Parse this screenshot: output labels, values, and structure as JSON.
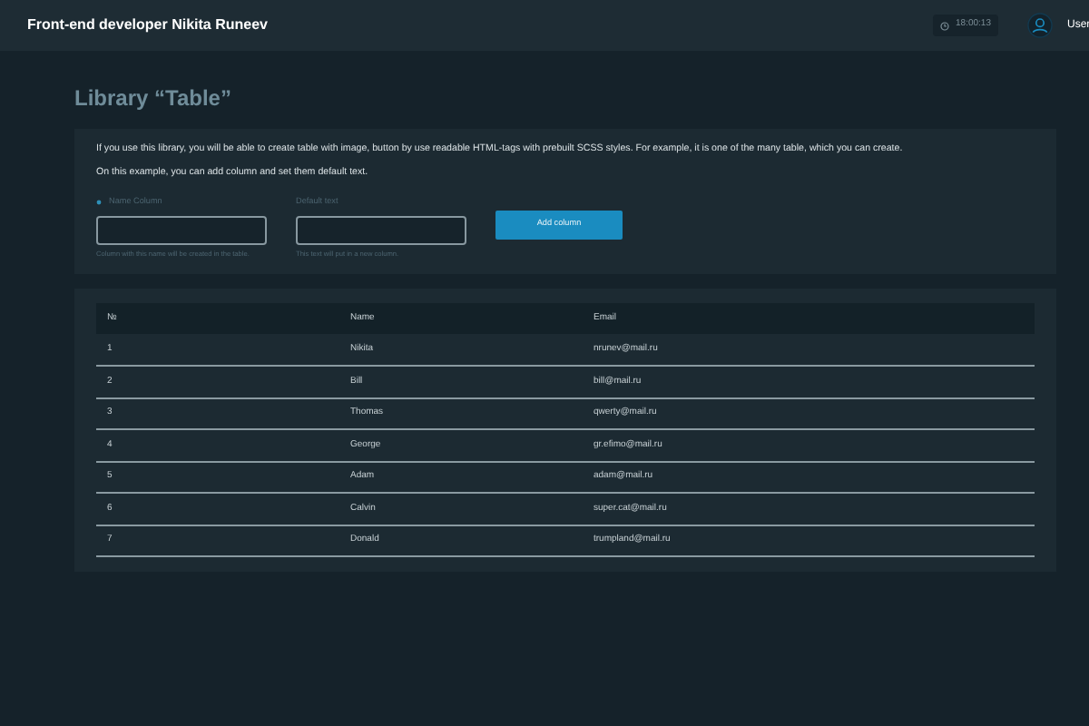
{
  "header": {
    "title": "Front-end developer Nikita Runeev",
    "time": "18:00:13",
    "user": "User"
  },
  "page_title": "Library “Table”",
  "intro": {
    "lines": [
      "If you use this library, you will be able to create table with image, button by use readable HTML-tags with prebuilt SCSS styles. For example, it is one of the many table, which you can create.",
      "On this example, you can add column and set them default text."
    ],
    "fields": [
      {
        "label": "Name Column",
        "required": true,
        "hint": "Column with this name will be created in the table."
      },
      {
        "label": "Default text",
        "required": false,
        "hint": "This text will put in a new column."
      }
    ],
    "button": "Add column"
  },
  "table": {
    "columns": [
      "№",
      "Name",
      "Email"
    ],
    "rows": [
      [
        "1",
        "Nikita",
        "nrunev@mail.ru"
      ],
      [
        "2",
        "Bill",
        "bill@mail.ru"
      ],
      [
        "3",
        "Thomas",
        "qwerty@mail.ru"
      ],
      [
        "4",
        "George",
        "gr.efimo@mail.ru"
      ],
      [
        "5",
        "Adam",
        "adam@mail.ru"
      ],
      [
        "6",
        "Calvin",
        "super.cat@mail.ru"
      ],
      [
        "7",
        "Donald",
        "trumpland@mail.ru"
      ]
    ]
  }
}
